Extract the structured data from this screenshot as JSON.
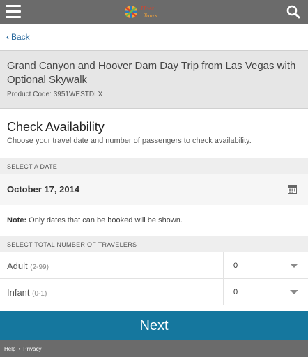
{
  "header": {
    "menu_icon": "hamburger-icon",
    "logo_icon": "host-logo",
    "search_icon": "search-icon"
  },
  "nav": {
    "back_label": "Back"
  },
  "product": {
    "title": "Grand Canyon and Hoover Dam Day Trip from Las Vegas with Optional Skywalk",
    "code_label": "Product Code:",
    "code_value": "3951WESTDLX"
  },
  "availability": {
    "title": "Check Availability",
    "subtitle": "Choose your travel date and number of passengers to check availability."
  },
  "date_section": {
    "header": "SELECT A DATE",
    "selected_date": "October 17, 2014",
    "calendar_icon": "calendar-icon",
    "note_label": "Note:",
    "note_text": "Only dates that can be booked will be shown."
  },
  "travelers_section": {
    "header": "SELECT TOTAL NUMBER OF TRAVELERS",
    "rows": [
      {
        "label": "Adult",
        "range": "(2-99)",
        "value": "0"
      },
      {
        "label": "Infant",
        "range": "(0-1)",
        "value": "0"
      }
    ]
  },
  "actions": {
    "next_label": "Next"
  },
  "footer": {
    "help_label": "Help",
    "separator": "•",
    "privacy_label": "Privacy"
  },
  "colors": {
    "topbar": "#6b6b6b",
    "accent": "#15779e",
    "link": "#2a6a9e"
  }
}
